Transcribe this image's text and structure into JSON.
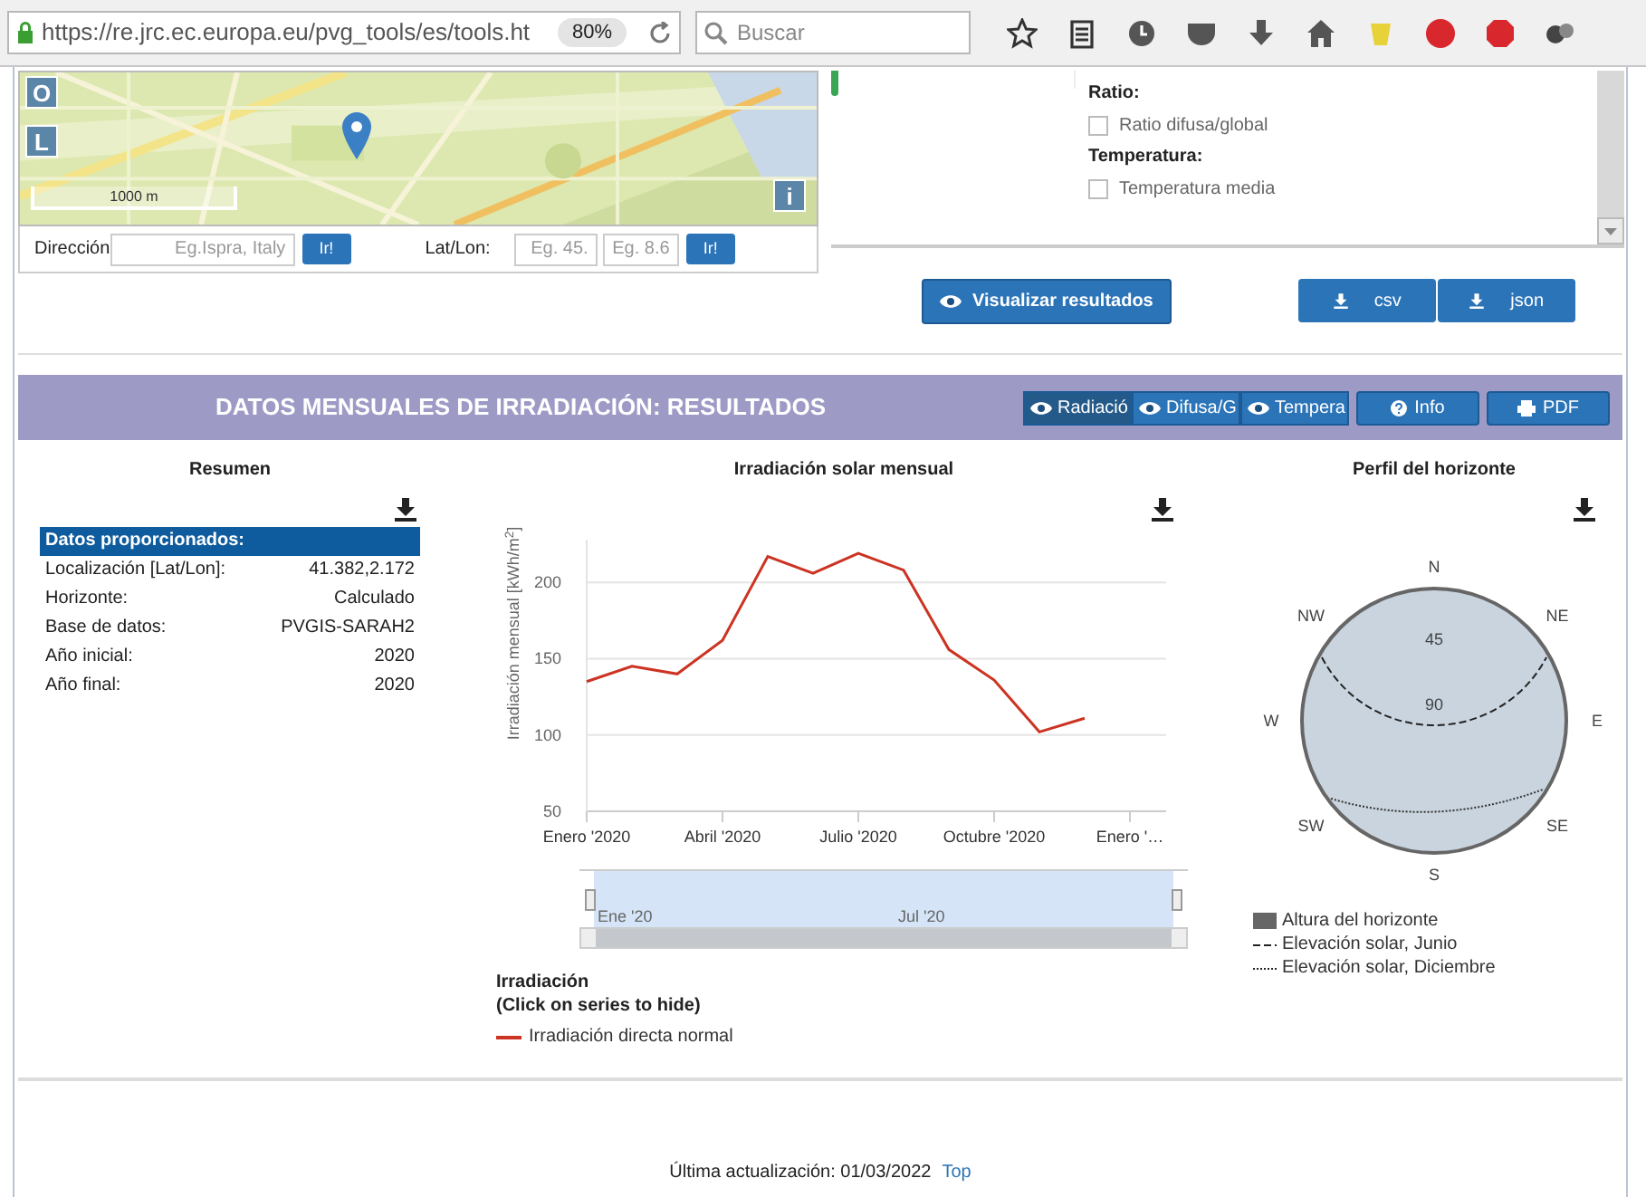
{
  "browser": {
    "url": "https://re.jrc.ec.europa.eu/pvg_tools/es/tools.ht",
    "zoom": "80%",
    "search": {
      "placeholder": "Buscar"
    }
  },
  "map": {
    "kind": "picture",
    "controls": [
      "O",
      "L"
    ],
    "info": "i",
    "scale": "1000 m"
  },
  "location_form": {
    "address_label": "Dirección",
    "address": {
      "placeholder": "Eg.Ispra, Italy"
    },
    "address_go": "Ir!",
    "latlon_label": "Lat/Lon:",
    "lat": {
      "placeholder": "Eg. 45."
    },
    "lon": {
      "placeholder": "Eg. 8.6"
    },
    "latlon_go": "Ir!"
  },
  "options_panel": {
    "groups": [
      {
        "title": "Ratio:",
        "options": [
          {
            "label": "Ratio difusa/global",
            "checked": false
          }
        ]
      },
      {
        "title": "Temperatura:",
        "options": [
          {
            "label": "Temperatura media",
            "checked": false
          }
        ]
      }
    ]
  },
  "actions": {
    "visualize": "Visualizar resultados",
    "downloads": [
      "csv",
      "json"
    ]
  },
  "results": {
    "title": "DATOS MENSUALES DE IRRADIACIÓN: RESULTADOS",
    "tabs": [
      {
        "label": "Radiació",
        "selected": true
      },
      {
        "label": "Difusa/G",
        "selected": false
      },
      {
        "label": "Tempera",
        "selected": false
      }
    ],
    "buttons": [
      {
        "kind": "info",
        "label": "Info"
      },
      {
        "kind": "pdf",
        "label": "PDF"
      }
    ]
  },
  "summary": {
    "title": "Resumen",
    "header": "Datos proporcionados:",
    "rows": [
      {
        "label": "Localización [Lat/Lon]:",
        "value": "41.382,2.172"
      },
      {
        "label": "Horizonte:",
        "value": "Calculado"
      },
      {
        "label": "Base de datos:",
        "value": "PVGIS-SARAH2"
      },
      {
        "label": "Año inicial:",
        "value": "2020"
      },
      {
        "label": "Año final:",
        "value": "2020"
      }
    ]
  },
  "monthly_chart": {
    "title": "Irradiación solar mensual",
    "chart_data": {
      "type": "line",
      "ylabel": "Irradiación mensual [kWh/m$^{2}$]",
      "categories": [
        "Enero '2020",
        null,
        null,
        "Abril '2020",
        null,
        null,
        "Julio '2020",
        null,
        null,
        "Octubre '2020",
        null,
        null,
        "Enero '…"
      ],
      "series": [
        {
          "name": "Irradiación directa normal",
          "color": "#cc3322",
          "values": [
            135,
            145,
            140,
            162,
            217,
            206,
            219,
            208,
            156,
            136,
            102,
            111,
            null
          ]
        }
      ],
      "ylim": [
        50,
        228
      ],
      "yticks": [
        50,
        100,
        150,
        200
      ],
      "grid": true
    },
    "navigator_labels": [
      "Ene '20",
      "Jul '20"
    ],
    "legend_title": "Irradiación",
    "legend_hint": "(Click on series to hide)"
  },
  "horizon": {
    "title": "Perfil del horizonte",
    "directions": [
      "N",
      "NE",
      "E",
      "SE",
      "S",
      "SW",
      "W",
      "NW"
    ],
    "rings": [
      "45",
      "90"
    ],
    "legend": [
      {
        "kind": "area",
        "label": "Altura del horizonte"
      },
      {
        "kind": "dashed",
        "label": "Elevación solar, Junio"
      },
      {
        "kind": "dotted",
        "label": "Elevación solar, Diciembre"
      }
    ]
  },
  "footer": {
    "updated": "Última actualización: 01/03/2022",
    "top_link": "Top"
  }
}
